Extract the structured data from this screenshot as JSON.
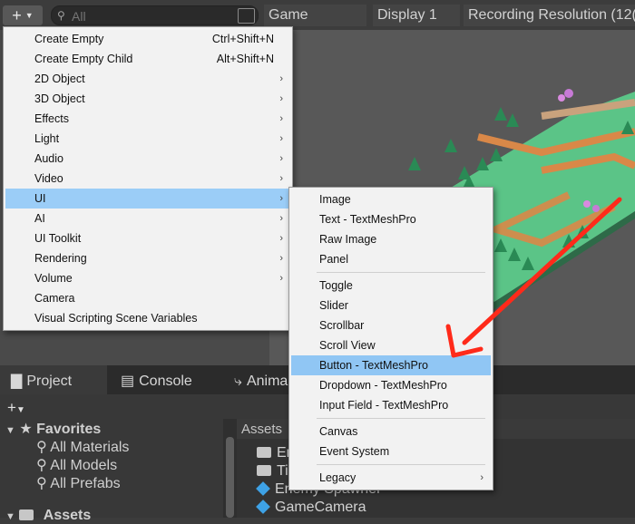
{
  "toolbar": {
    "add_symbol": "+",
    "search_placeholder": "All",
    "game_tab": "Game",
    "display": "Display 1",
    "resolution": "Recording Resolution (12("
  },
  "create_menu": {
    "items": [
      {
        "label": "Create Empty",
        "shortcut": "Ctrl+Shift+N"
      },
      {
        "label": "Create Empty Child",
        "shortcut": "Alt+Shift+N"
      },
      {
        "label": "2D Object"
      },
      {
        "label": "3D Object"
      },
      {
        "label": "Effects"
      },
      {
        "label": "Light"
      },
      {
        "label": "Audio"
      },
      {
        "label": "Video"
      },
      {
        "label": "UI"
      },
      {
        "label": "AI"
      },
      {
        "label": "UI Toolkit"
      },
      {
        "label": "Rendering"
      },
      {
        "label": "Volume"
      },
      {
        "label": "Camera"
      },
      {
        "label": "Visual Scripting Scene Variables"
      }
    ],
    "arrow": "›"
  },
  "ui_submenu": {
    "items": [
      "Image",
      "Text - TextMeshPro",
      "Raw Image",
      "Panel",
      "Toggle",
      "Slider",
      "Scrollbar",
      "Scroll View",
      "Button - TextMeshPro",
      "Dropdown - TextMeshPro",
      "Input Field - TextMeshPro",
      "Canvas",
      "Event System",
      "Legacy"
    ]
  },
  "bottom_tabs": {
    "project": "Project",
    "console": "Console",
    "animation": "Anima"
  },
  "project": {
    "add_symbol": "+",
    "favorites": "Favorites",
    "favorites_items": [
      "All Materials",
      "All Models",
      "All Prefabs"
    ],
    "assets_root": "Assets",
    "breadcrumb": "Assets",
    "assets": [
      "En",
      "Til",
      "Enemy Spawner",
      "GameCamera"
    ]
  },
  "colors": {
    "highlight": "#9bcdf7",
    "arrow": "#ff2a1a",
    "ground": "#56c083",
    "path": "#d98848"
  }
}
